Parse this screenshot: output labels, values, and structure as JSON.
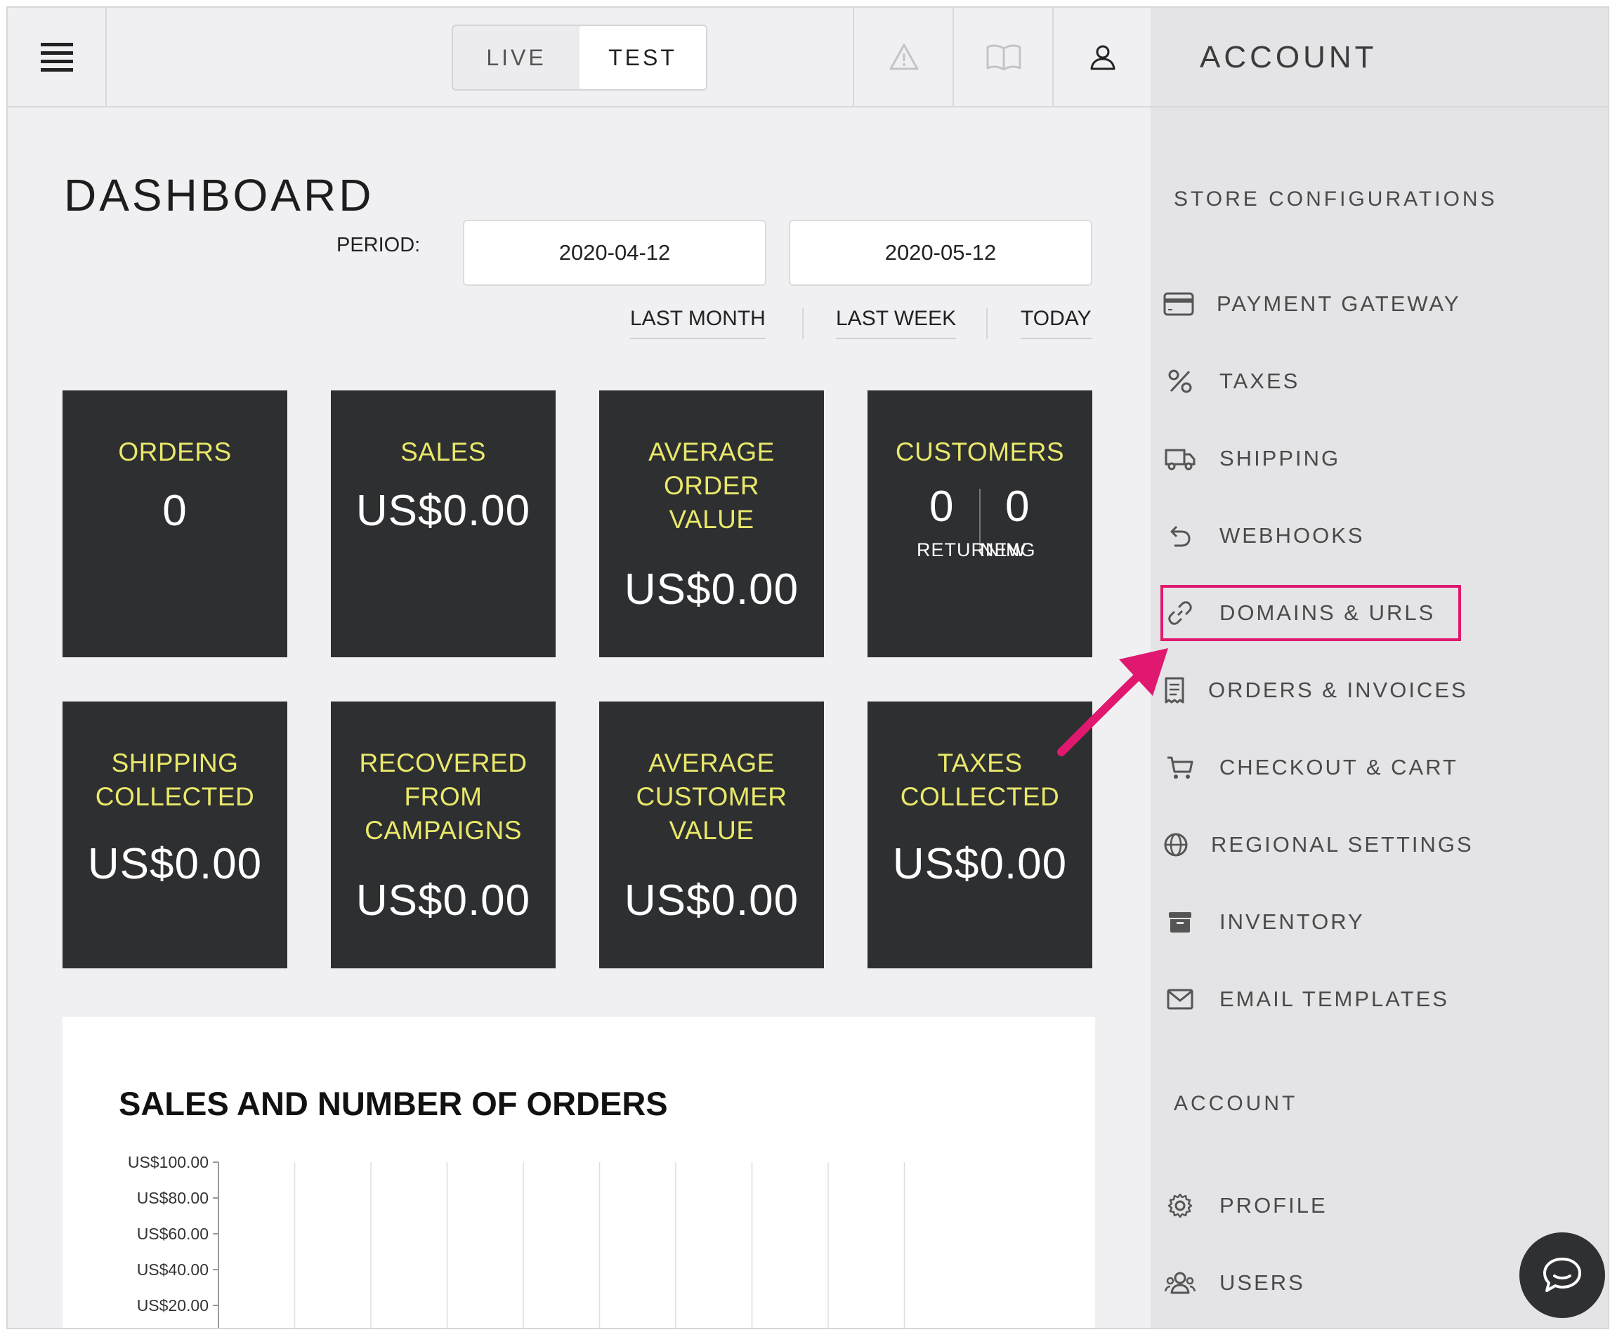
{
  "topbar": {
    "mode_options": [
      "LIVE",
      "TEST"
    ],
    "active_mode": "TEST",
    "sidebar_title": "ACCOUNT"
  },
  "dashboard": {
    "title": "DASHBOARD",
    "period_label": "PERIOD:",
    "date_from": "2020-04-12",
    "date_to": "2020-05-12",
    "quick_ranges": [
      "LAST MONTH",
      "LAST WEEK",
      "TODAY"
    ]
  },
  "tiles": {
    "orders": {
      "label": "ORDERS",
      "value": "0"
    },
    "sales": {
      "label": "SALES",
      "value": "US$0.00"
    },
    "aov": {
      "label_lines": [
        "AVERAGE",
        "ORDER",
        "VALUE"
      ],
      "value": "US$0.00"
    },
    "customers": {
      "label": "CUSTOMERS",
      "returning_value": "0",
      "new_value": "0",
      "returning_label": "RETURNING",
      "new_label": "NEW"
    },
    "shipping": {
      "label_lines": [
        "SHIPPING",
        "COLLECTED"
      ],
      "value": "US$0.00"
    },
    "recovered": {
      "label_lines": [
        "RECOVERED",
        "FROM",
        "CAMPAIGNS"
      ],
      "value": "US$0.00"
    },
    "acv": {
      "label_lines": [
        "AVERAGE",
        "CUSTOMER",
        "VALUE"
      ],
      "value": "US$0.00"
    },
    "taxes": {
      "label_lines": [
        "TAXES",
        "COLLECTED"
      ],
      "value": "US$0.00"
    }
  },
  "chart_data": {
    "type": "line",
    "title": "SALES AND NUMBER OF ORDERS",
    "y_ticks": [
      100,
      80,
      60,
      40,
      20
    ],
    "y_tick_labels": [
      "US$100.00",
      "US$80.00",
      "US$60.00",
      "US$40.00",
      "US$20.00"
    ],
    "ylim": [
      0,
      100
    ],
    "vertical_gridlines": 11,
    "series": [],
    "grid": true
  },
  "sidebar": {
    "section_store": "STORE CONFIGURATIONS",
    "store_items": [
      {
        "label": "PAYMENT GATEWAY",
        "icon": "credit-card-icon"
      },
      {
        "label": "TAXES",
        "icon": "percent-icon"
      },
      {
        "label": "SHIPPING",
        "icon": "truck-icon"
      },
      {
        "label": "WEBHOOKS",
        "icon": "undo-arrow-icon"
      },
      {
        "label": "DOMAINS & URLS",
        "icon": "link-icon"
      },
      {
        "label": "ORDERS & INVOICES",
        "icon": "receipt-icon"
      },
      {
        "label": "CHECKOUT & CART",
        "icon": "cart-icon"
      },
      {
        "label": "REGIONAL SETTINGS",
        "icon": "globe-icon"
      },
      {
        "label": "INVENTORY",
        "icon": "archive-icon"
      },
      {
        "label": "EMAIL TEMPLATES",
        "icon": "envelope-icon"
      }
    ],
    "section_account": "ACCOUNT",
    "account_items": [
      {
        "label": "PROFILE",
        "icon": "gear-icon"
      },
      {
        "label": "USERS",
        "icon": "users-icon"
      }
    ],
    "highlighted_item": "DOMAINS & URLS"
  },
  "colors": {
    "tile_bg": "#2e2f31",
    "tile_label": "#e9e86a",
    "highlight": "#e0186f",
    "background": "#f0f0f2",
    "sidebar_bg": "#e4e4e6"
  }
}
